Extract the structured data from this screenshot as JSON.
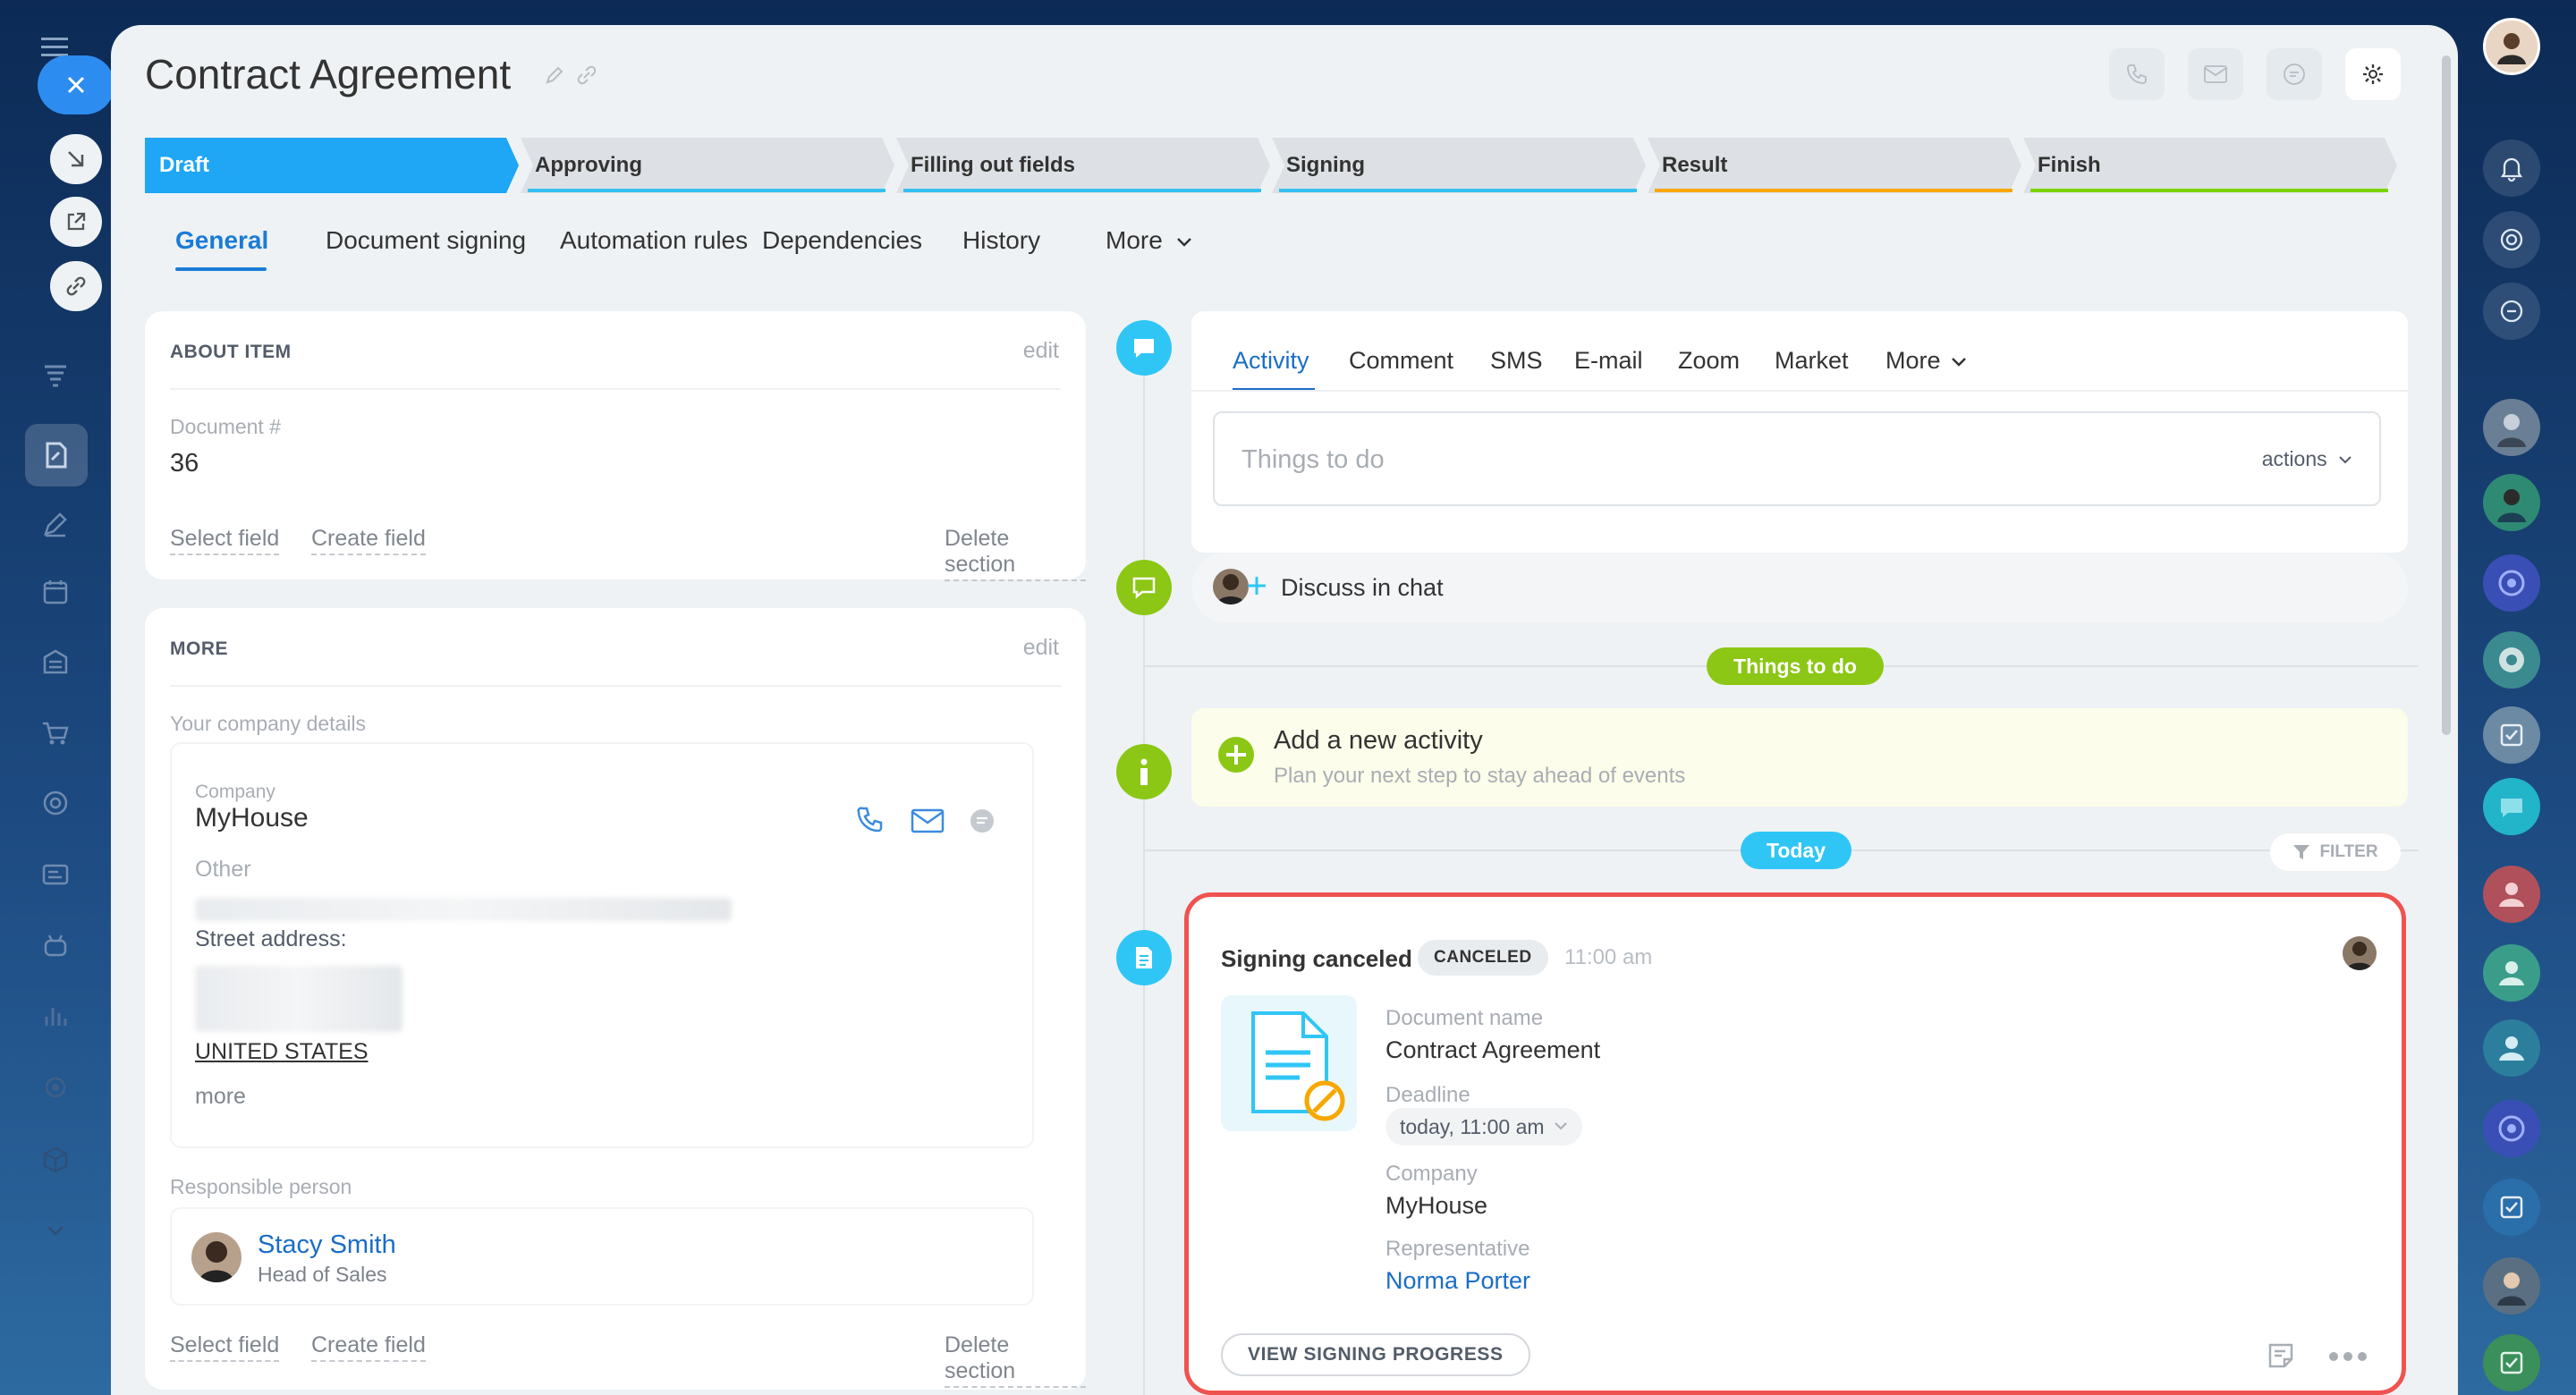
{
  "app": {
    "title": "Contract Agreement"
  },
  "stages": [
    {
      "label": "Draft",
      "color": "#1fa6f5",
      "underline": "#1fa6f5"
    },
    {
      "label": "Approving",
      "color": "#dde1e5",
      "underline": "#36c0f0"
    },
    {
      "label": "Filling out fields",
      "color": "#dde1e5",
      "underline": "#36c0f0"
    },
    {
      "label": "Signing",
      "color": "#dde1e5",
      "underline": "#36c0f0"
    },
    {
      "label": "Result",
      "color": "#dde1e5",
      "underline": "#f7a700"
    },
    {
      "label": "Finish",
      "color": "#dde1e5",
      "underline": "#7bd500"
    }
  ],
  "tabs": [
    "General",
    "Document signing",
    "Automation rules",
    "Dependencies",
    "History",
    "More"
  ],
  "about": {
    "title": "ABOUT ITEM",
    "edit": "edit",
    "doc_label": "Document #",
    "doc_value": "36",
    "select": "Select field",
    "create": "Create field",
    "delete": "Delete section"
  },
  "more": {
    "title": "MORE",
    "edit": "edit",
    "company_details": "Your company details",
    "company_label": "Company",
    "company_value": "MyHouse",
    "other": "Other",
    "street": "Street address:",
    "country": "UNITED STATES",
    "more_link": "more",
    "responsible_label": "Responsible person",
    "person_name": "Stacy Smith",
    "person_role": "Head of Sales",
    "select": "Select field",
    "create": "Create field",
    "delete": "Delete section"
  },
  "activity": {
    "tabs": [
      "Activity",
      "Comment",
      "SMS",
      "E-mail",
      "Zoom",
      "Market",
      "More"
    ],
    "placeholder": "Things to do",
    "actions": "actions"
  },
  "discuss": {
    "label": "Discuss in chat"
  },
  "things_pill": "Things to do",
  "add_activity": {
    "title": "Add a new activity",
    "subtitle": "Plan your next step to stay ahead of events"
  },
  "today_pill": "Today",
  "filter": "FILTER",
  "signing": {
    "title": "Signing canceled",
    "badge": "CANCELED",
    "time": "11:00 am",
    "doc_name_label": "Document name",
    "doc_name": "Contract Agreement",
    "deadline_label": "Deadline",
    "deadline": "today, 11:00 am",
    "company_label": "Company",
    "company": "MyHouse",
    "rep_label": "Representative",
    "rep": "Norma Porter",
    "view_btn": "VIEW SIGNING PROGRESS"
  },
  "colors": {
    "accent": "#1a7bd8",
    "highlight": "#ef5350",
    "green": "#8bc714",
    "cyan": "#2fc6f6"
  }
}
